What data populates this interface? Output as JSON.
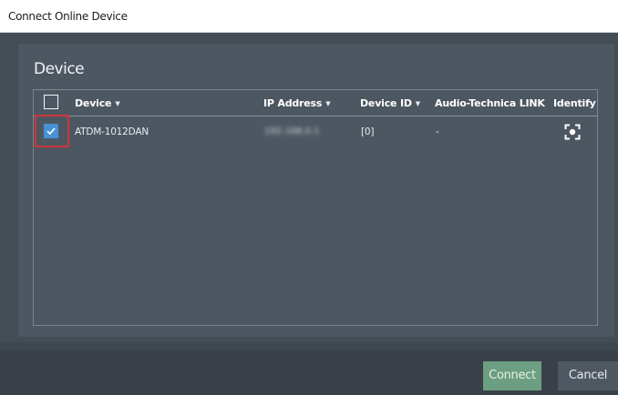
{
  "window": {
    "title": "Connect Online Device"
  },
  "section": {
    "title": "Device"
  },
  "table": {
    "columns": [
      {
        "label": "Device",
        "sortable": true
      },
      {
        "label": "IP Address",
        "sortable": true
      },
      {
        "label": "Device ID",
        "sortable": true
      },
      {
        "label": "Audio-Technica LINK",
        "sortable": false
      },
      {
        "label": "Identify",
        "sortable": false
      }
    ],
    "header_checkbox_checked": false,
    "rows": [
      {
        "checked": true,
        "device": "ATDM-1012DAN",
        "ip_address": "192.168.0.1",
        "device_id": "[0]",
        "at_link": "-",
        "identify_icon": "target-icon"
      }
    ]
  },
  "footer": {
    "connect_label": "Connect",
    "cancel_label": "Cancel"
  },
  "colors": {
    "connect": "#6c9e82",
    "checkbox": "#4a90d6",
    "highlight": "#d0353a"
  }
}
